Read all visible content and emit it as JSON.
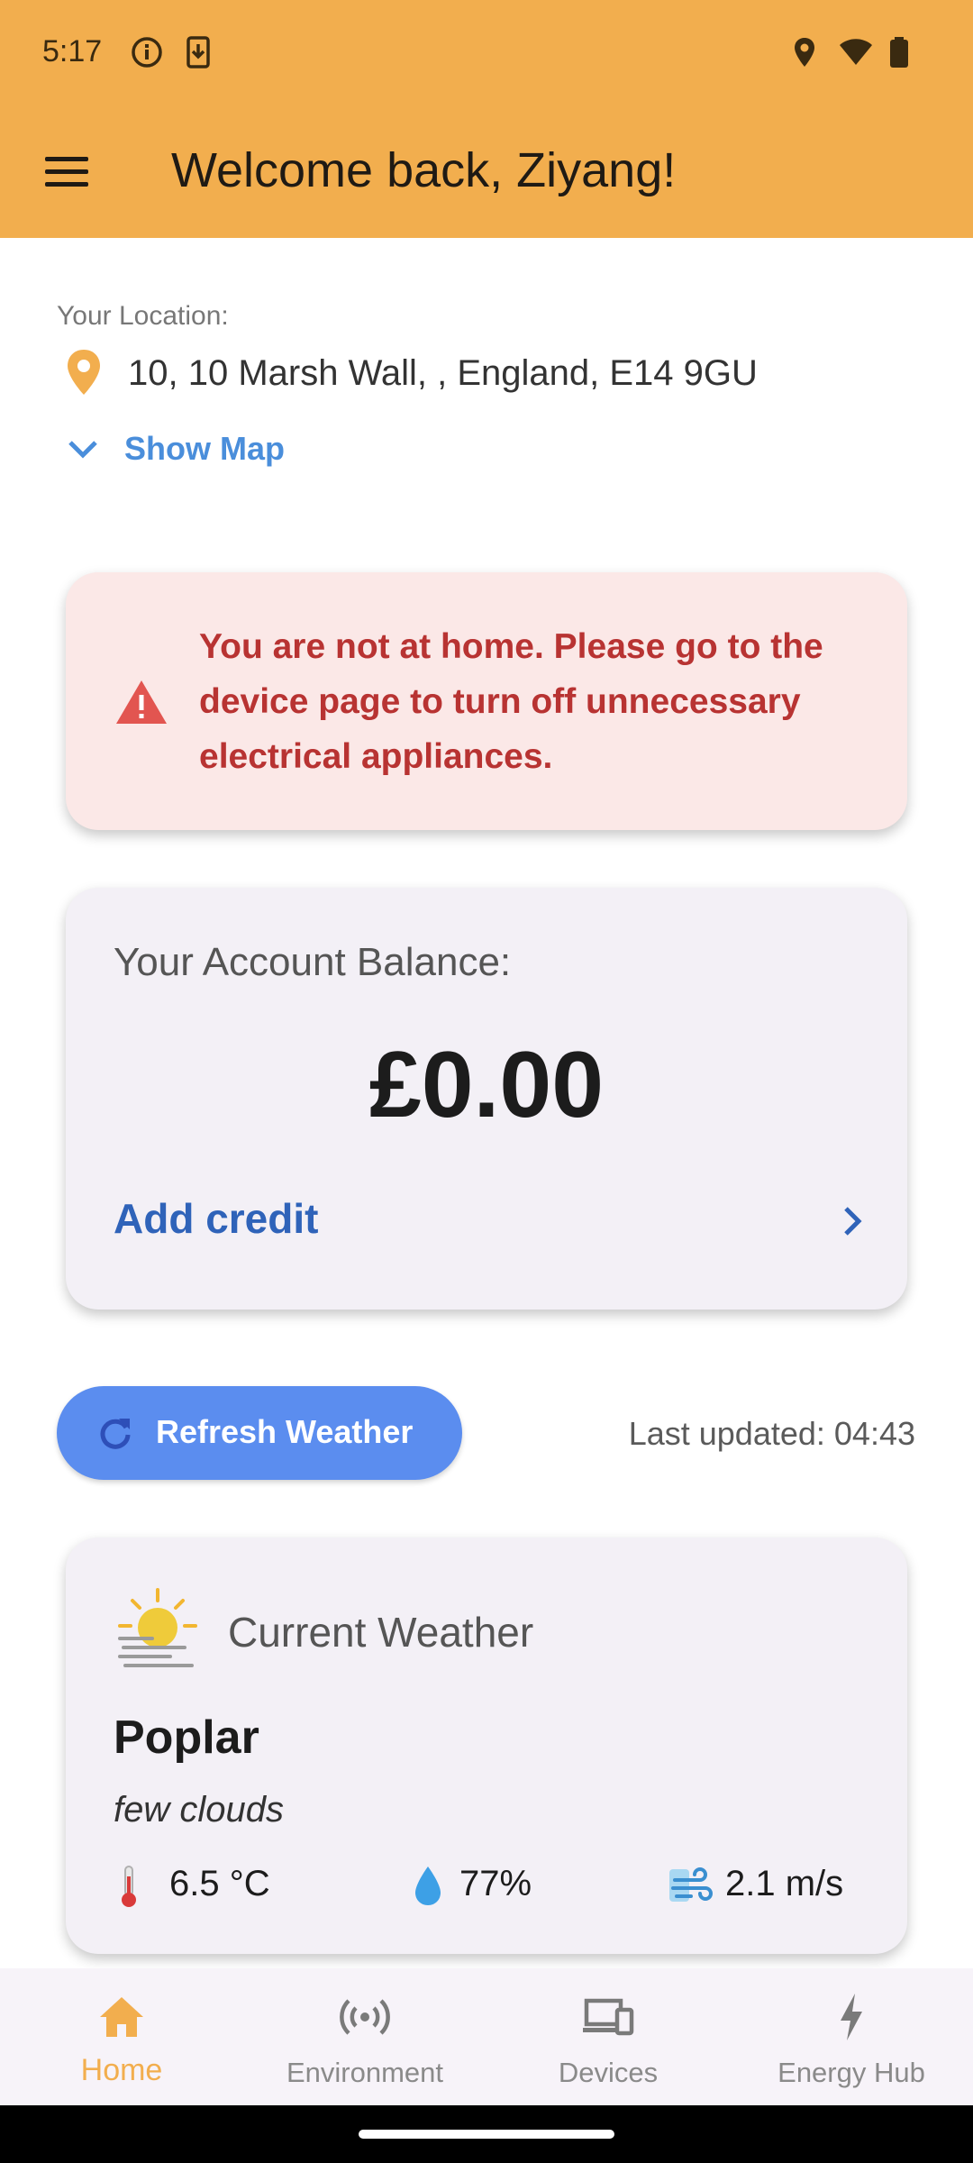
{
  "status_bar": {
    "time": "5:17",
    "icons": [
      "info-icon",
      "download-icon",
      "location-icon",
      "wifi-icon",
      "battery-icon"
    ]
  },
  "app_bar": {
    "title": "Welcome back, Ziyang!",
    "background": "#F2AE4E"
  },
  "location": {
    "label": "Your Location:",
    "address": "10, 10 Marsh Wall, , England, E14 9GU",
    "show_map_label": "Show Map"
  },
  "alert": {
    "message": "You are not at home. Please go to the device page to turn off unnecessary electrical appliances.",
    "color": "#B83332"
  },
  "balance": {
    "label": "Your Account Balance:",
    "amount": "£0.00",
    "add_credit_label": "Add credit"
  },
  "weather_controls": {
    "refresh_label": "Refresh Weather",
    "last_updated": "Last updated: 04:43"
  },
  "weather": {
    "title": "Current Weather",
    "city": "Poplar",
    "description": "few clouds",
    "temperature": "6.5 °C",
    "humidity": "77%",
    "wind": "2.1 m/s"
  },
  "bottom_nav": {
    "items": [
      {
        "label": "Home",
        "icon": "home-icon",
        "active": true
      },
      {
        "label": "Environment",
        "icon": "sensors-icon",
        "active": false
      },
      {
        "label": "Devices",
        "icon": "devices-icon",
        "active": false
      },
      {
        "label": "Energy Hub",
        "icon": "bolt-icon",
        "active": false
      }
    ],
    "active_color": "#F2AE4E"
  }
}
